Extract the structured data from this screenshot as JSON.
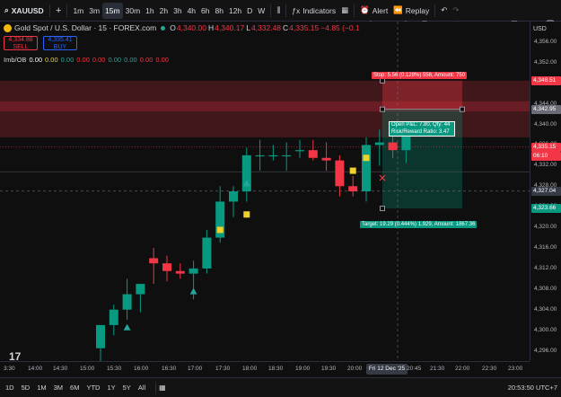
{
  "toolbar": {
    "symbol": "XAUUSD",
    "add_symbol": "+",
    "intervals": [
      "1m",
      "3m",
      "15m",
      "30m",
      "1h",
      "2h",
      "3h",
      "4h",
      "6h",
      "8h",
      "12h",
      "D",
      "W"
    ],
    "active_interval": "15m",
    "indicators_label": "Indicators",
    "alert_label": "Alert",
    "replay_label": "Replay"
  },
  "legend": {
    "title": "Gold Spot / U.S. Dollar · 15 · FOREX.com",
    "open": "4,340.00",
    "high": "4,340.17",
    "low": "4,332.48",
    "close": "4,335.15",
    "change": "−4.85 (−0.1"
  },
  "pricebox": {
    "sell_price": "4,334.88",
    "sell_label": "SELL",
    "buy_price": "4,335.41",
    "buy_label": "BUY"
  },
  "indicator": {
    "name": "Imb/OB",
    "values": [
      "0.00",
      "0.00",
      "0.00",
      "0.00",
      "0.00",
      "0.00",
      "0.00",
      "0.00",
      "0.00"
    ]
  },
  "price_axis": {
    "currency": "USD",
    "ticks": [
      "4,356.00",
      "4,352.00",
      "4,344.00",
      "4,340.00",
      "4,336.00",
      "4,332.00",
      "4,328.00",
      "4,324.00",
      "4,320.00",
      "4,316.00",
      "4,312.00",
      "4,308.00",
      "4,304.00",
      "4,300.00",
      "4,296.00"
    ],
    "labels": {
      "stop": "4,348.51",
      "entry": "4,342.95",
      "last": "4,335.15",
      "countdown": "06:10",
      "cursor": "4,327.04",
      "target": "4,323.66"
    }
  },
  "time_axis": {
    "ticks": [
      "3:30",
      "14:00",
      "14:30",
      "15:00",
      "15:30",
      "16:00",
      "16:30",
      "17:00",
      "17:30",
      "18:00",
      "18:30",
      "19:00",
      "19:30",
      "20:00",
      "20:45",
      "21:30",
      "22:00",
      "22:30",
      "23:00"
    ],
    "cursor_label": "Fri 12 Dec '25"
  },
  "position": {
    "stop_text": "Stop: 5.56 (0.128%) 556, Amount: 750",
    "target_text": "Target: 19.29 (0.444%) 1,929, Amount: 1867.36",
    "pnl_line1": "Open P&L: 7.80, Qty: 44",
    "pnl_line2": "Risk/Reward Ratio: 3.47"
  },
  "bottombar": {
    "ranges": [
      "1D",
      "5D",
      "1M",
      "3M",
      "6M",
      "YTD",
      "1Y",
      "5Y",
      "All"
    ],
    "clock": "20:53:50 UTC+7"
  },
  "colors": {
    "up": "#089981",
    "down": "#f23645",
    "background": "#0f0f0f",
    "stop_zone": "#f23645",
    "target_zone": "#089981"
  },
  "chart_data": {
    "type": "candlestick",
    "x": [
      "15:00",
      "15:15",
      "15:30",
      "15:45",
      "16:00",
      "16:15",
      "16:30",
      "16:45",
      "17:00",
      "17:15",
      "17:30",
      "17:45",
      "18:00",
      "18:15",
      "18:30",
      "18:45",
      "19:00",
      "19:15",
      "19:30",
      "19:45",
      "20:00",
      "20:15",
      "20:30",
      "20:45"
    ],
    "open": [
      4296.5,
      4301,
      4304,
      4307,
      4314,
      4313,
      4311.5,
      4311,
      4312,
      4318,
      4325,
      4327,
      4334,
      4334,
      4334,
      4335,
      4335,
      4333.5,
      4333,
      4328,
      4327,
      4336,
      4336.5,
      4335
    ],
    "high": [
      4300,
      4305,
      4310,
      4309,
      4316,
      4314.5,
      4313,
      4313.5,
      4319.5,
      4328,
      4328,
      4335.5,
      4337,
      4336,
      4336.5,
      4337,
      4337,
      4336.5,
      4334,
      4330,
      4337.5,
      4339,
      4340,
      4340.2
    ],
    "low": [
      4294,
      4299,
      4302,
      4303.5,
      4309,
      4309.5,
      4310,
      4306,
      4311,
      4317,
      4322,
      4325,
      4331,
      4333,
      4331,
      4333.5,
      4333,
      4331,
      4326,
      4326,
      4325,
      4332,
      4333.5,
      4332.5
    ],
    "close": [
      4301,
      4304,
      4307,
      4309,
      4313,
      4311.5,
      4311,
      4312,
      4318,
      4325,
      4327,
      4334,
      4334,
      4334,
      4334,
      4335,
      4333.5,
      4333,
      4328,
      4327,
      4336,
      4336.5,
      4335,
      4340
    ],
    "ylim": [
      4294,
      4360
    ],
    "markers": [
      {
        "type": "triangle-up",
        "x": "15:30",
        "y": 4300.5,
        "color": "#26a69a"
      },
      {
        "type": "triangle-up",
        "x": "16:45",
        "y": 4307.5,
        "color": "#26a69a"
      },
      {
        "type": "triangle-up",
        "x": "17:45",
        "y": 4328.5,
        "color": "#26a69a"
      },
      {
        "type": "square",
        "x": "17:15",
        "y": 4319.5,
        "color": "#f0d12a"
      },
      {
        "type": "square",
        "x": "17:45",
        "y": 4322.5,
        "color": "#f0d12a"
      },
      {
        "type": "square",
        "x": "19:45",
        "y": 4331,
        "color": "#f0d12a"
      },
      {
        "type": "square",
        "x": "20:00",
        "y": 4333.5,
        "color": "#f0d12a"
      }
    ],
    "position_tool": {
      "entry": 4342.95,
      "stop": 4348.51,
      "target": 4323.66
    },
    "zones": [
      {
        "from": 4337.5,
        "to": 4344.5,
        "color": "#f23645"
      },
      {
        "from": 4342.5,
        "to": 4348.5,
        "color": "#f23645"
      }
    ]
  }
}
